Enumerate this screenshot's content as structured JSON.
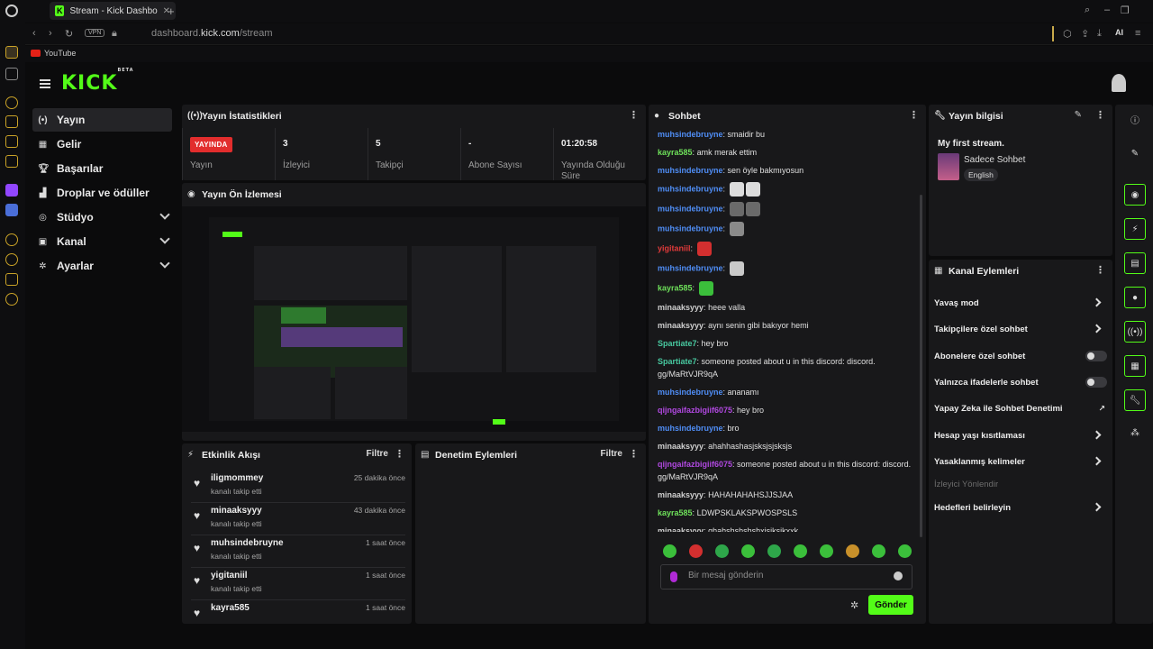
{
  "browser": {
    "tab_title": "Stream - Kick Dashboard",
    "tab_favicon": "K",
    "url_prefix": "dashboard.",
    "url_domain": "kick.com",
    "url_path": "/stream",
    "vpn_label": "VPN",
    "bookmark_youtube": "YouTube",
    "ai_label": "AI"
  },
  "kick": {
    "logo": "KICK",
    "logo_sup": "BETA",
    "accent": "#53fc18"
  },
  "nav": [
    {
      "label": "Yayın",
      "icon": "broadcast-icon",
      "active": true
    },
    {
      "label": "Gelir",
      "icon": "revenue-icon"
    },
    {
      "label": "Başarılar",
      "icon": "trophy-icon"
    },
    {
      "label": "Droplar ve ödüller",
      "icon": "drops-icon"
    },
    {
      "label": "Stüdyo",
      "icon": "studio-icon",
      "expandable": true
    },
    {
      "label": "Kanal",
      "icon": "channel-icon",
      "expandable": true
    },
    {
      "label": "Ayarlar",
      "icon": "gear-icon",
      "expandable": true
    }
  ],
  "stats": {
    "title": "Yayın İstatistikleri",
    "live_badge": "YAYINDA",
    "items": [
      {
        "value": "",
        "label": "Yayın"
      },
      {
        "value": "3",
        "label": "İzleyici"
      },
      {
        "value": "5",
        "label": "Takipçi"
      },
      {
        "value": "-",
        "label": "Abone Sayısı"
      },
      {
        "value": "01:20:58",
        "label": "Yayında Olduğu Süre"
      }
    ]
  },
  "preview": {
    "title": "Yayın Ön İzlemesi"
  },
  "feed": {
    "title": "Etkinlik Akışı",
    "filter": "Filtre",
    "items": [
      {
        "user": "iligmommey",
        "sub": "kanalı takip etti",
        "time": "25 dakika önce"
      },
      {
        "user": "minaaksyyy",
        "sub": "kanalı takip etti",
        "time": "43 dakika önce"
      },
      {
        "user": "muhsindebruyne",
        "sub": "kanalı takip etti",
        "time": "1 saat önce"
      },
      {
        "user": "yigitaniil",
        "sub": "kanalı takip etti",
        "time": "1 saat önce"
      },
      {
        "user": "kayra585",
        "sub": "",
        "time": "1 saat önce"
      }
    ]
  },
  "mod": {
    "title": "Denetim Eylemleri",
    "filter": "Filtre"
  },
  "chat": {
    "title": "Sohbet",
    "messages": [
      {
        "user": "muhsindebruyne",
        "color": "#4f8df5",
        "text": "smaidir bu"
      },
      {
        "user": "kayra585",
        "color": "#6ee05a",
        "text": "amk merak ettim"
      },
      {
        "user": "muhsindebruyne",
        "color": "#4f8df5",
        "text": "sen öyle bakmıyosun"
      },
      {
        "user": "muhsindebruyne",
        "color": "#4f8df5",
        "text": "",
        "emotes": [
          "#dcdcdc",
          "#dcdcdc"
        ]
      },
      {
        "user": "muhsindebruyne",
        "color": "#4f8df5",
        "text": "",
        "emotes": [
          "#6a6a6a",
          "#6a6a6a"
        ]
      },
      {
        "user": "muhsindebruyne",
        "color": "#4f8df5",
        "text": "",
        "emotes": [
          "#8a8a8a"
        ]
      },
      {
        "user": "yigitaniil",
        "color": "#e23a3a",
        "text": "",
        "emotes": [
          "#d32f2f"
        ]
      },
      {
        "user": "muhsindebruyne",
        "color": "#4f8df5",
        "text": "",
        "emotes": [
          "#c9c9c9"
        ]
      },
      {
        "user": "kayra585",
        "color": "#6ee05a",
        "text": "",
        "emotes": [
          "#3bbf3b"
        ]
      },
      {
        "user": "minaaksyyy",
        "color": "#cfcfcf",
        "text": "heee valla"
      },
      {
        "user": "minaaksyyy",
        "color": "#cfcfcf",
        "text": "aynı senin gibi bakıyor hemi"
      },
      {
        "user": "Spartiate7",
        "color": "#48c9a0",
        "text": "hey bro"
      },
      {
        "user": "Spartiate7",
        "color": "#48c9a0",
        "text": "someone posted about u in this discord: discord. gg/MaRtVJR9qA"
      },
      {
        "user": "muhsindebruyne",
        "color": "#4f8df5",
        "text": "ananamı"
      },
      {
        "user": "qijngaifazbigiif6075",
        "color": "#b048e0",
        "text": "hey bro"
      },
      {
        "user": "muhsindebruyne",
        "color": "#4f8df5",
        "text": "bro"
      },
      {
        "user": "minaaksyyy",
        "color": "#cfcfcf",
        "text": "ahahhashasjsksjsjsksjs"
      },
      {
        "user": "qijngaifazbigiif6075",
        "color": "#b048e0",
        "text": "someone posted about u in this discord: discord. gg/MaRtVJR9qA"
      },
      {
        "user": "minaaksyyy",
        "color": "#cfcfcf",
        "text": "HAHAHAHAHSJJSJAA"
      },
      {
        "user": "kayra585",
        "color": "#6ee05a",
        "text": "LDWPSKLAKSPWOSPSLS"
      },
      {
        "user": "minaaksyyy",
        "color": "#cfcfcf",
        "text": "qhahshshshshxjsjksjkxxk"
      }
    ],
    "placeholder": "Bir mesaj gönderin",
    "send": "Gönder"
  },
  "info": {
    "title": "Yayın bilgisi",
    "stream_title": "My first stream.",
    "category": "Sadece Sohbet",
    "language": "English"
  },
  "actions": {
    "title": "Kanal Eylemleri",
    "items": [
      {
        "label": "Yavaş mod",
        "kind": "arrow"
      },
      {
        "label": "Takipçilere özel sohbet",
        "kind": "arrow"
      },
      {
        "label": "Abonelere özel sohbet",
        "kind": "toggle"
      },
      {
        "label": "Yalnızca ifadelerle sohbet",
        "kind": "toggle"
      },
      {
        "label": "Yapay Zeka ile Sohbet Denetimi",
        "kind": "external"
      },
      {
        "label": "Hesap yaşı kısıtlaması",
        "kind": "arrow"
      },
      {
        "label": "Yasaklanmış kelimeler",
        "kind": "arrow"
      },
      {
        "label": "İzleyici Yönlendir",
        "kind": "disabled"
      },
      {
        "label": "Hedefleri belirleyin",
        "kind": "arrow"
      }
    ]
  }
}
